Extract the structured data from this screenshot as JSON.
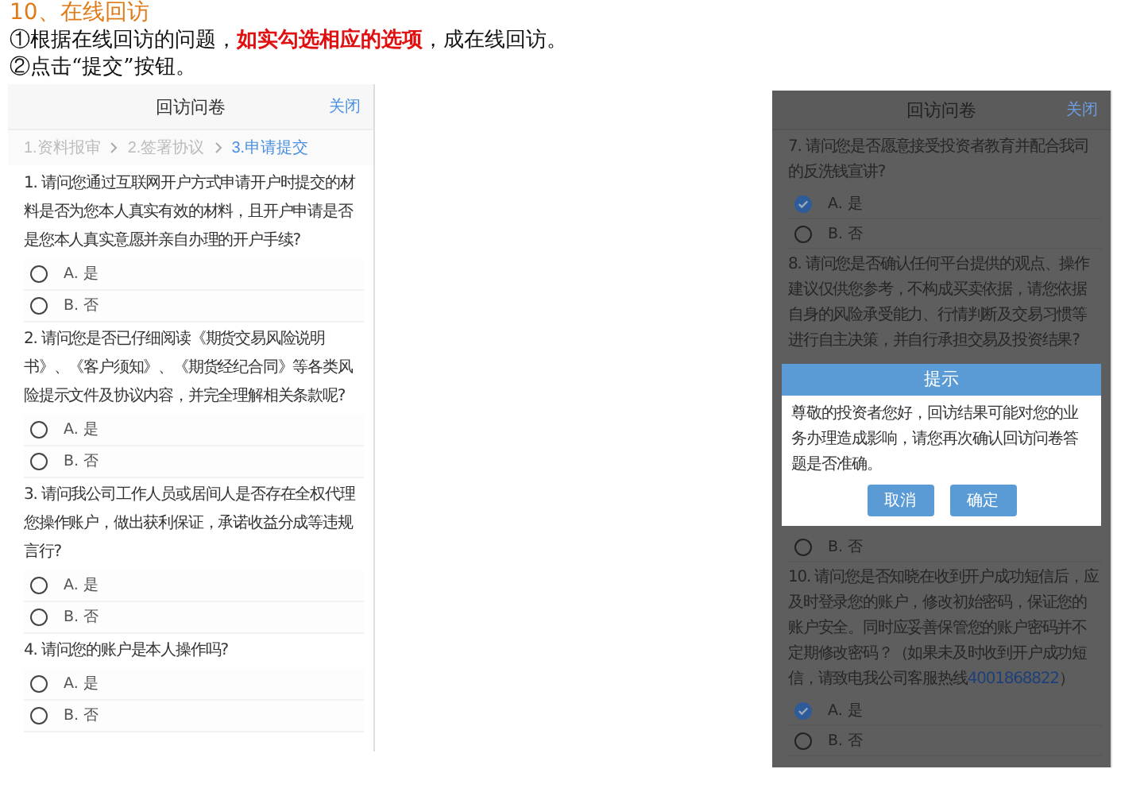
{
  "heading": "10、在线回访",
  "instructions": [
    {
      "parts": [
        {
          "text": "①根据在线回访的问题，",
          "kind": "plain"
        },
        {
          "text": "如实勾选相应的选项",
          "kind": "highlight"
        },
        {
          "text": "，成在线回访。",
          "kind": "plain"
        }
      ]
    },
    {
      "parts": [
        {
          "text": "②点击“提交”按钮。",
          "kind": "plain"
        }
      ]
    }
  ],
  "left_screen": {
    "title": "回访问卷",
    "close": "关闭",
    "steps": [
      {
        "label": "1.资料报审",
        "selected": false
      },
      {
        "label": "2.签署协议",
        "selected": false
      },
      {
        "label": "3.申请提交",
        "selected": true
      }
    ],
    "questions": [
      {
        "text": "1. 请问您通过互联网开户方式申请开户时提交的材料是否为您本人真实有效的材料，且开户申请是否是您本人真实意愿并亲自办理的开户手续?",
        "options": [
          {
            "label": "A. 是",
            "selected": false
          },
          {
            "label": "B. 否",
            "selected": false
          }
        ]
      },
      {
        "text": "2. 请问您是否已仔细阅读《期货交易风险说明书》、《客户须知》、《期货经纪合同》等各类风险提示文件及协议内容，并完全理解相关条款呢?",
        "options": [
          {
            "label": "A. 是",
            "selected": false
          },
          {
            "label": "B. 否",
            "selected": false
          }
        ]
      },
      {
        "text": "3. 请问我公司工作人员或居间人是否存在全权代理您操作账户，做出获利保证，承诺收益分成等违规言行?",
        "options": [
          {
            "label": "A. 是",
            "selected": false
          },
          {
            "label": "B. 否",
            "selected": false
          }
        ]
      },
      {
        "text": "4. 请问您的账户是本人操作吗?",
        "options": [
          {
            "label": "A. 是",
            "selected": false
          },
          {
            "label": "B. 否",
            "selected": false
          }
        ]
      }
    ]
  },
  "right_screen": {
    "title": "回访问卷",
    "close": "关闭",
    "questions_above": [
      {
        "text": "7. 请问您是否愿意接受投资者教育并配合我司的反洗钱宣讲?",
        "options": [
          {
            "label": "A. 是",
            "selected": true
          },
          {
            "label": "B. 否",
            "selected": false
          }
        ]
      },
      {
        "text": "8. 请问您是否确认任何平台提供的观点、操作建议仅供您参考，不构成买卖依据，请您依据自身的风险承受能力、行情判断及交易习惯等进行自主决策，并自行承担交易及投资结果?"
      }
    ],
    "dialog": {
      "title": "提示",
      "message": "尊敬的投资者您好，回访结果可能对您的业务办理造成影响，请您再次确认回访问卷答题是否准确。",
      "buttons": [
        "取消",
        "确定"
      ]
    },
    "options_below": [
      {
        "label": "B. 否",
        "selected": false
      }
    ],
    "questions_below": [
      {
        "text": "10. 请问您是否知晓在收到开户成功短信后，应及时登录您的账户，修改初始密码，保证您的账户安全。同时应妥善保管您的账户密码并不定期修改密码？（如果未及时收到开户成功短信，请致电我公司客服热线",
        "link": "4001868822",
        "tail": "）",
        "options": [
          {
            "label": "A. 是",
            "selected": true
          },
          {
            "label": "B. 否",
            "selected": false
          }
        ]
      }
    ]
  }
}
